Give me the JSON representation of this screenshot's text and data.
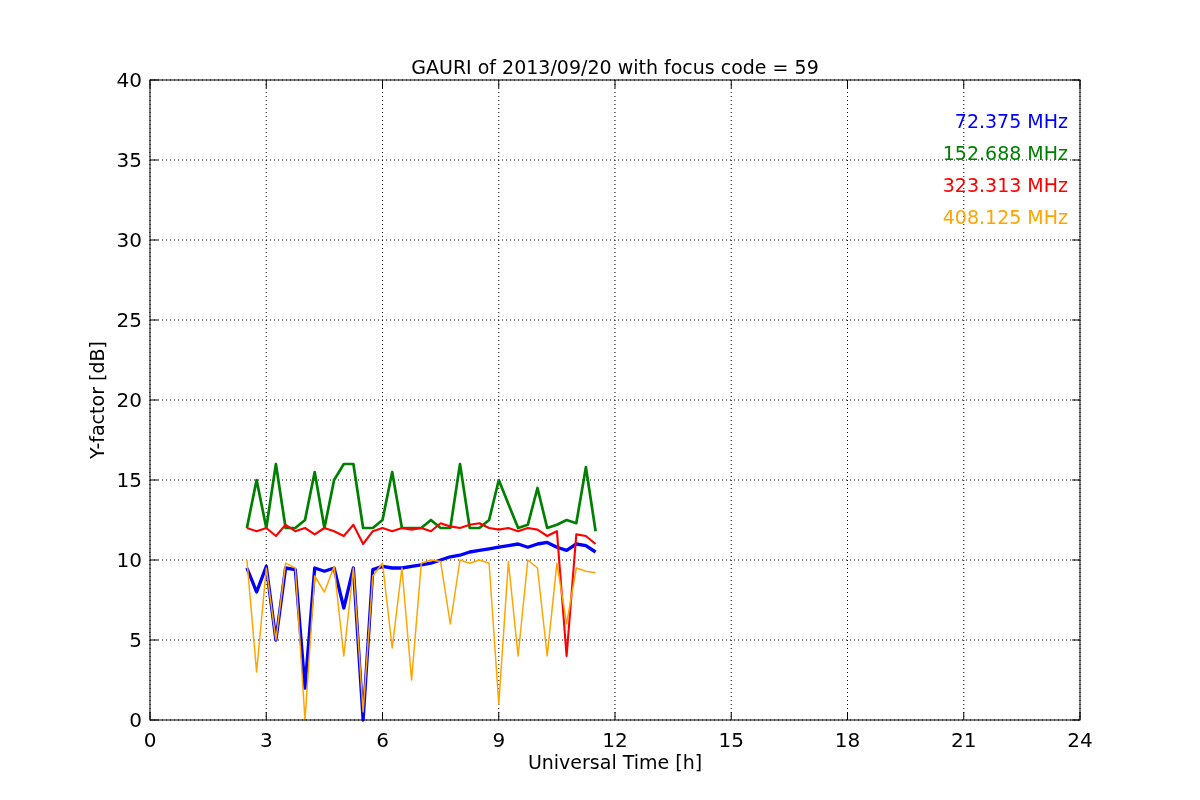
{
  "chart_data": {
    "type": "line",
    "title": "GAURI of 2013/09/20 with focus code = 59",
    "xlabel": "Universal Time [h]",
    "ylabel": "Y-factor [dB]",
    "x": [
      2.5,
      2.75,
      3,
      3.25,
      3.5,
      3.75,
      4,
      4.25,
      4.5,
      4.75,
      5,
      5.25,
      5.5,
      5.75,
      6,
      6.25,
      6.5,
      6.75,
      7,
      7.25,
      7.5,
      7.75,
      8,
      8.25,
      8.5,
      8.75,
      9,
      9.25,
      9.5,
      9.75,
      10,
      10.25,
      10.5,
      10.75,
      11,
      11.25,
      11.5
    ],
    "series": [
      {
        "name": "72.375 MHz",
        "color": "#0000ff",
        "values": [
          9.5,
          8,
          9.6,
          5,
          9.5,
          9.4,
          2,
          9.5,
          9.3,
          9.5,
          7,
          9.5,
          0,
          9.4,
          9.6,
          9.5,
          9.5,
          9.6,
          9.7,
          9.8,
          10,
          10.2,
          10.3,
          10.5,
          10.6,
          10.7,
          10.8,
          10.9,
          11,
          10.8,
          11,
          11.1,
          10.8,
          10.6,
          11,
          10.9,
          10.5
        ]
      },
      {
        "name": "152.688 MHz",
        "color": "#008000",
        "values": [
          12,
          15,
          12,
          16,
          12,
          12,
          12.5,
          15.5,
          12,
          15,
          16,
          16,
          12,
          12,
          12.5,
          15.5,
          12,
          12,
          12,
          12.5,
          12,
          12,
          16,
          12,
          12,
          12.5,
          15,
          13.5,
          12,
          12.2,
          14.5,
          12,
          12.2,
          12.5,
          12.3,
          15.8,
          11.8
        ]
      },
      {
        "name": "323.313 MHz",
        "color": "#ff0000",
        "values": [
          12,
          11.8,
          12,
          11.5,
          12.2,
          11.8,
          12,
          11.6,
          12,
          11.8,
          11.5,
          12.2,
          11,
          11.8,
          12,
          11.8,
          12,
          11.9,
          12,
          11.8,
          12.3,
          12.1,
          12,
          12.2,
          12.3,
          12,
          11.9,
          12,
          11.8,
          12,
          11.9,
          11.5,
          11.8,
          4,
          11.6,
          11.5,
          11
        ]
      },
      {
        "name": "408.125 MHz",
        "color": "#ffa500",
        "values": [
          10,
          3,
          9.5,
          5,
          9.8,
          9.5,
          0,
          9,
          8,
          9.6,
          4,
          9.5,
          0.5,
          9,
          9.8,
          4.5,
          9.5,
          2.5,
          9.8,
          10,
          9.9,
          6,
          10,
          9.8,
          10,
          9.8,
          1,
          9.9,
          4,
          10,
          9.5,
          4,
          9.8,
          6,
          9.5,
          9.3,
          9.2
        ]
      }
    ],
    "xlim": [
      0,
      24
    ],
    "ylim": [
      0,
      40
    ],
    "xticks": [
      0,
      3,
      6,
      9,
      12,
      15,
      18,
      21,
      24
    ],
    "yticks": [
      0,
      5,
      10,
      15,
      20,
      25,
      30,
      35,
      40
    ],
    "grid": true
  }
}
